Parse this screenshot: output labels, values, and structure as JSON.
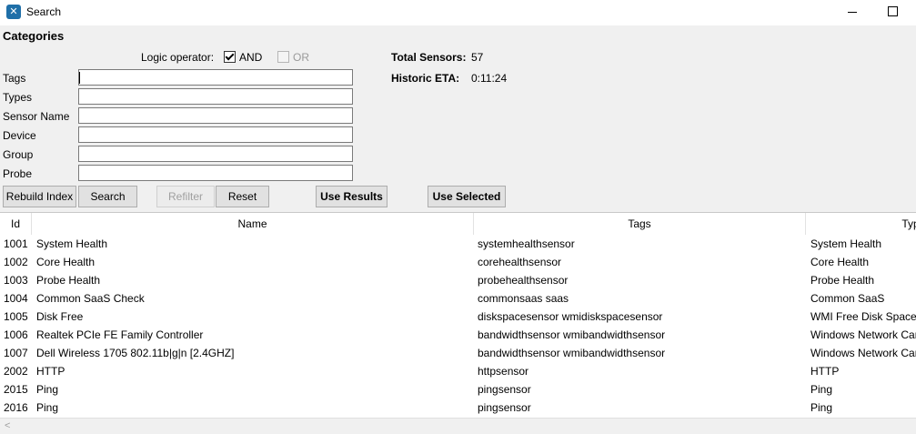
{
  "window": {
    "title": "Search",
    "icon": "app-logo-icon"
  },
  "categories_label": "Categories",
  "logic": {
    "label": "Logic operator:",
    "and_label": "AND",
    "and_checked": true,
    "or_label": "OR",
    "or_checked": false,
    "or_enabled": false
  },
  "stats": {
    "total_label": "Total Sensors:",
    "total_value": "57",
    "eta_label": "Historic ETA:",
    "eta_value": "0:11:24"
  },
  "filters": {
    "tags": {
      "label": "Tags",
      "value": ""
    },
    "types": {
      "label": "Types",
      "value": ""
    },
    "sensor_name": {
      "label": "Sensor Name",
      "value": ""
    },
    "device": {
      "label": "Device",
      "value": ""
    },
    "group": {
      "label": "Group",
      "value": ""
    },
    "probe": {
      "label": "Probe",
      "value": ""
    }
  },
  "buttons": {
    "rebuild_index": "Rebuild Index",
    "search": "Search",
    "refilter": "Refilter",
    "reset": "Reset",
    "use_results": "Use Results",
    "use_selected": "Use Selected"
  },
  "table": {
    "columns": [
      "Id",
      "Name",
      "Tags",
      "Typ"
    ],
    "rows": [
      {
        "id": "1001",
        "name": "System Health",
        "tags": "systemhealthsensor",
        "type": "System Health"
      },
      {
        "id": "1002",
        "name": "Core Health",
        "tags": "corehealthsensor",
        "type": "Core Health"
      },
      {
        "id": "1003",
        "name": "Probe Health",
        "tags": "probehealthsensor",
        "type": "Probe Health"
      },
      {
        "id": "1004",
        "name": "Common SaaS Check",
        "tags": "commonsaas saas",
        "type": "Common SaaS"
      },
      {
        "id": "1005",
        "name": "Disk Free",
        "tags": "diskspacesensor wmidiskspacesensor",
        "type": "WMI Free Disk Space ("
      },
      {
        "id": "1006",
        "name": "Realtek PCIe FE Family Controller",
        "tags": "bandwidthsensor wmibandwidthsensor",
        "type": "Windows Network Car"
      },
      {
        "id": "1007",
        "name": "Dell Wireless 1705 802.11b|g|n [2.4GHZ]",
        "tags": "bandwidthsensor wmibandwidthsensor",
        "type": "Windows Network Car"
      },
      {
        "id": "2002",
        "name": "HTTP",
        "tags": "httpsensor",
        "type": "HTTP"
      },
      {
        "id": "2015",
        "name": "Ping",
        "tags": "pingsensor",
        "type": "Ping"
      },
      {
        "id": "2016",
        "name": "Ping",
        "tags": "pingsensor",
        "type": "Ping"
      }
    ]
  }
}
